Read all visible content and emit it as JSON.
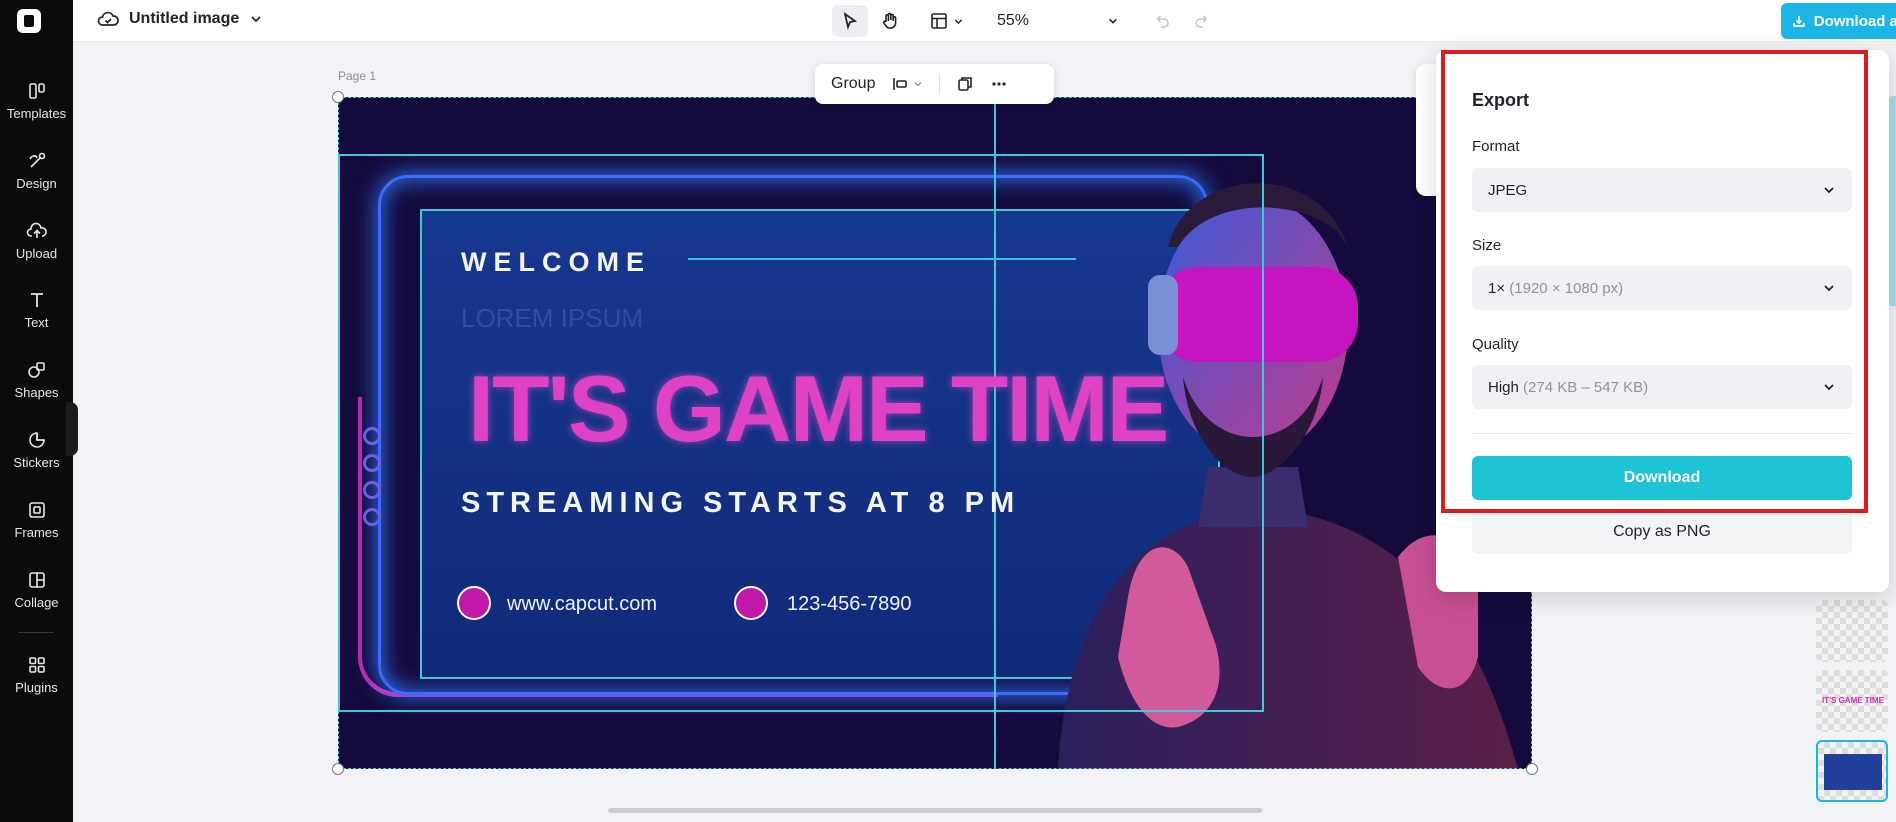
{
  "topbar": {
    "title": "Untitled image",
    "zoom": "55%",
    "download_all": "Download all"
  },
  "sidebar": {
    "items": [
      {
        "label": "Templates"
      },
      {
        "label": "Design"
      },
      {
        "label": "Upload"
      },
      {
        "label": "Text"
      },
      {
        "label": "Shapes"
      },
      {
        "label": "Stickers"
      },
      {
        "label": "Frames"
      },
      {
        "label": "Collage"
      },
      {
        "label": "Plugins"
      }
    ]
  },
  "canvas": {
    "page_label": "Page 1",
    "group_toolbar": {
      "group_label": "Group"
    },
    "artwork": {
      "welcome": "WELCOME",
      "lorem": "LOREM IPSUM",
      "headline": "IT'S GAME TIME",
      "subline": "STREAMING STARTS AT 8 PM",
      "website": "www.capcut.com",
      "phone": "123-456-7890"
    }
  },
  "thumbnails": {
    "mini_headline": "IT'S GAME TIME"
  },
  "export": {
    "title": "Export",
    "format_label": "Format",
    "format_value": "JPEG",
    "size_label": "Size",
    "size_value": "1×",
    "size_detail": "(1920 × 1080 px)",
    "quality_label": "Quality",
    "quality_value": "High",
    "quality_detail": "(274 KB – 547 KB)",
    "download_label": "Download",
    "copy_label": "Copy as PNG"
  },
  "colors": {
    "accent": "#1bb6e6",
    "download_button": "#1fc3d6",
    "highlight_outline": "#e0191f",
    "headline_pink": "#e042c4",
    "selection_cyan": "#41c7d8"
  }
}
